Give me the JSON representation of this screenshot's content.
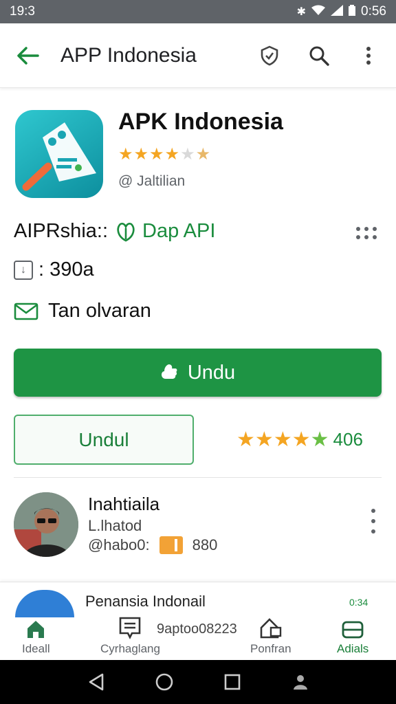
{
  "status_bar": {
    "time": "19:3",
    "right_time": "0:56",
    "icons": [
      "bluetooth-icon",
      "wifi-icon",
      "signal-icon",
      "battery-icon"
    ]
  },
  "app_bar": {
    "title": "APP Indonesia",
    "actions": [
      "shield-icon",
      "search-icon",
      "more-vert-icon"
    ]
  },
  "app": {
    "name": "APK Indonesia",
    "rating": 3.5,
    "publisher": "@ Jaltilian"
  },
  "details": {
    "compat_label": "AIPRshia::",
    "compat_link": "Dap API",
    "size": ": 390a",
    "mail_text": "Tan olvaran"
  },
  "buttons": {
    "install": "Undu",
    "secondary": "Undul"
  },
  "side_rating": {
    "stars": 4.5,
    "count": "406"
  },
  "review": {
    "name": "Inahtiaila",
    "sub": "L.lhatod",
    "meta": "@habo0:",
    "score": "880"
  },
  "peek": {
    "title": "Penansia Indonail",
    "badge": "0:34"
  },
  "bottom_nav": [
    {
      "label": "Ideall",
      "icon": "home-icon",
      "active": false
    },
    {
      "label": "Cyrhaglang",
      "icon": "document-icon",
      "active": false
    },
    {
      "label": "Ponfran",
      "icon": "house-badge-icon",
      "active": false
    },
    {
      "label": "Adials",
      "icon": "tray-icon",
      "active": true
    }
  ],
  "bottom_center_text": "9aptoo08223",
  "colors": {
    "primary_green": "#1e9444",
    "link_green": "#1a8c3d",
    "star_orange": "#f4a522",
    "app_icon_teal": "#1fb2bd"
  }
}
